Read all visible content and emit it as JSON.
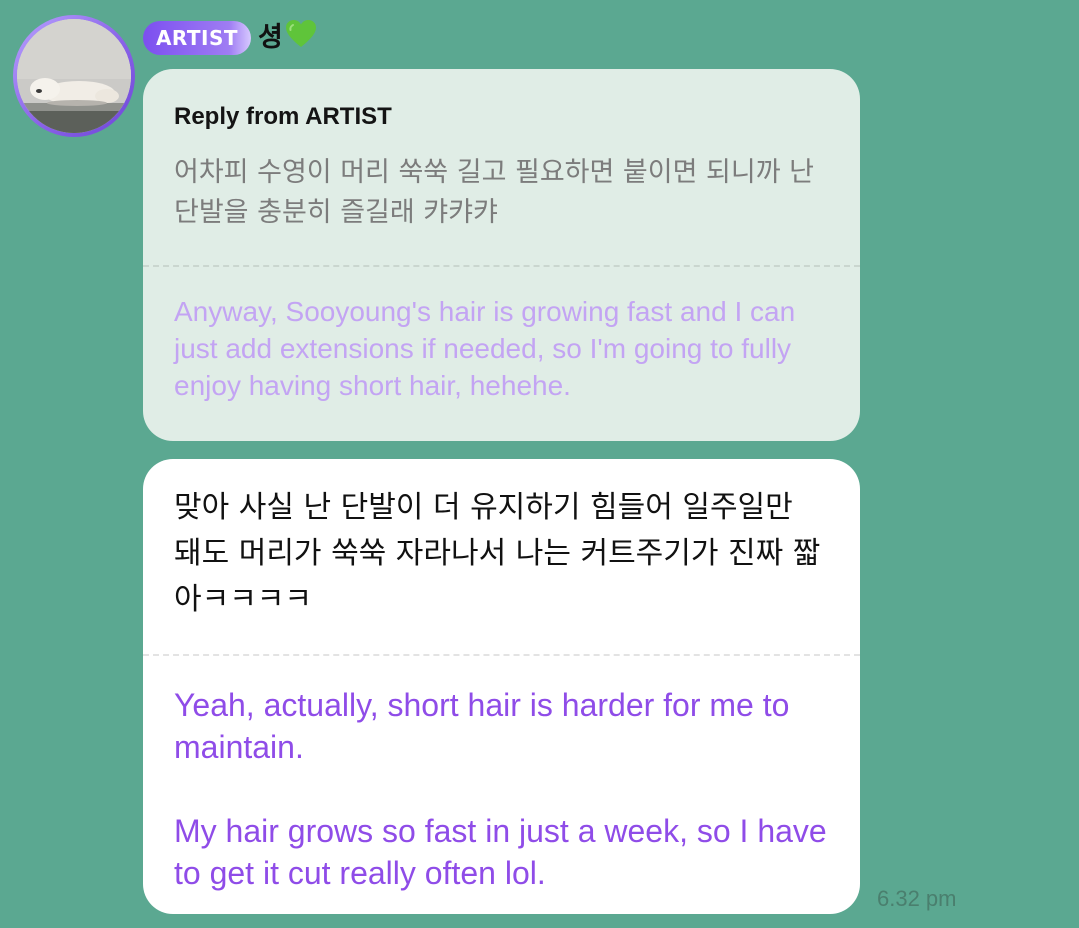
{
  "sender": {
    "badge": "ARTIST",
    "name": "셩",
    "emoji_icon": "green-heart-icon"
  },
  "reply": {
    "label": "Reply from ARTIST",
    "korean": "어차피 수영이 머리 쑥쑥 길고 필요하면 붙이면 되니까 난 단발을 충분히 즐길래 캬캬캬",
    "english": "Anyway, Sooyoung's hair is growing fast and I can just add extensions if needed, so I'm going to fully enjoy having short hair, hehehe."
  },
  "message": {
    "korean": "맞아 사실 난 단발이 더 유지하기 힘들어 일주일만 돼도 머리가 쑥쑥 자라나서 나는 커트주기가 진짜 짧아ㅋㅋㅋㅋ",
    "english_1": "Yeah, actually, short hair is harder for me to maintain.",
    "english_2": "My hair grows so fast in just a week, so I have to get it cut really often lol.",
    "time": "6.32 pm"
  },
  "colors": {
    "background": "#5ba891",
    "reply_bubble": "#e0ede6",
    "message_bubble": "#ffffff",
    "reply_translation": "#c3a4f3",
    "message_translation": "#8f4ce8",
    "badge": "#7c4ff0"
  }
}
